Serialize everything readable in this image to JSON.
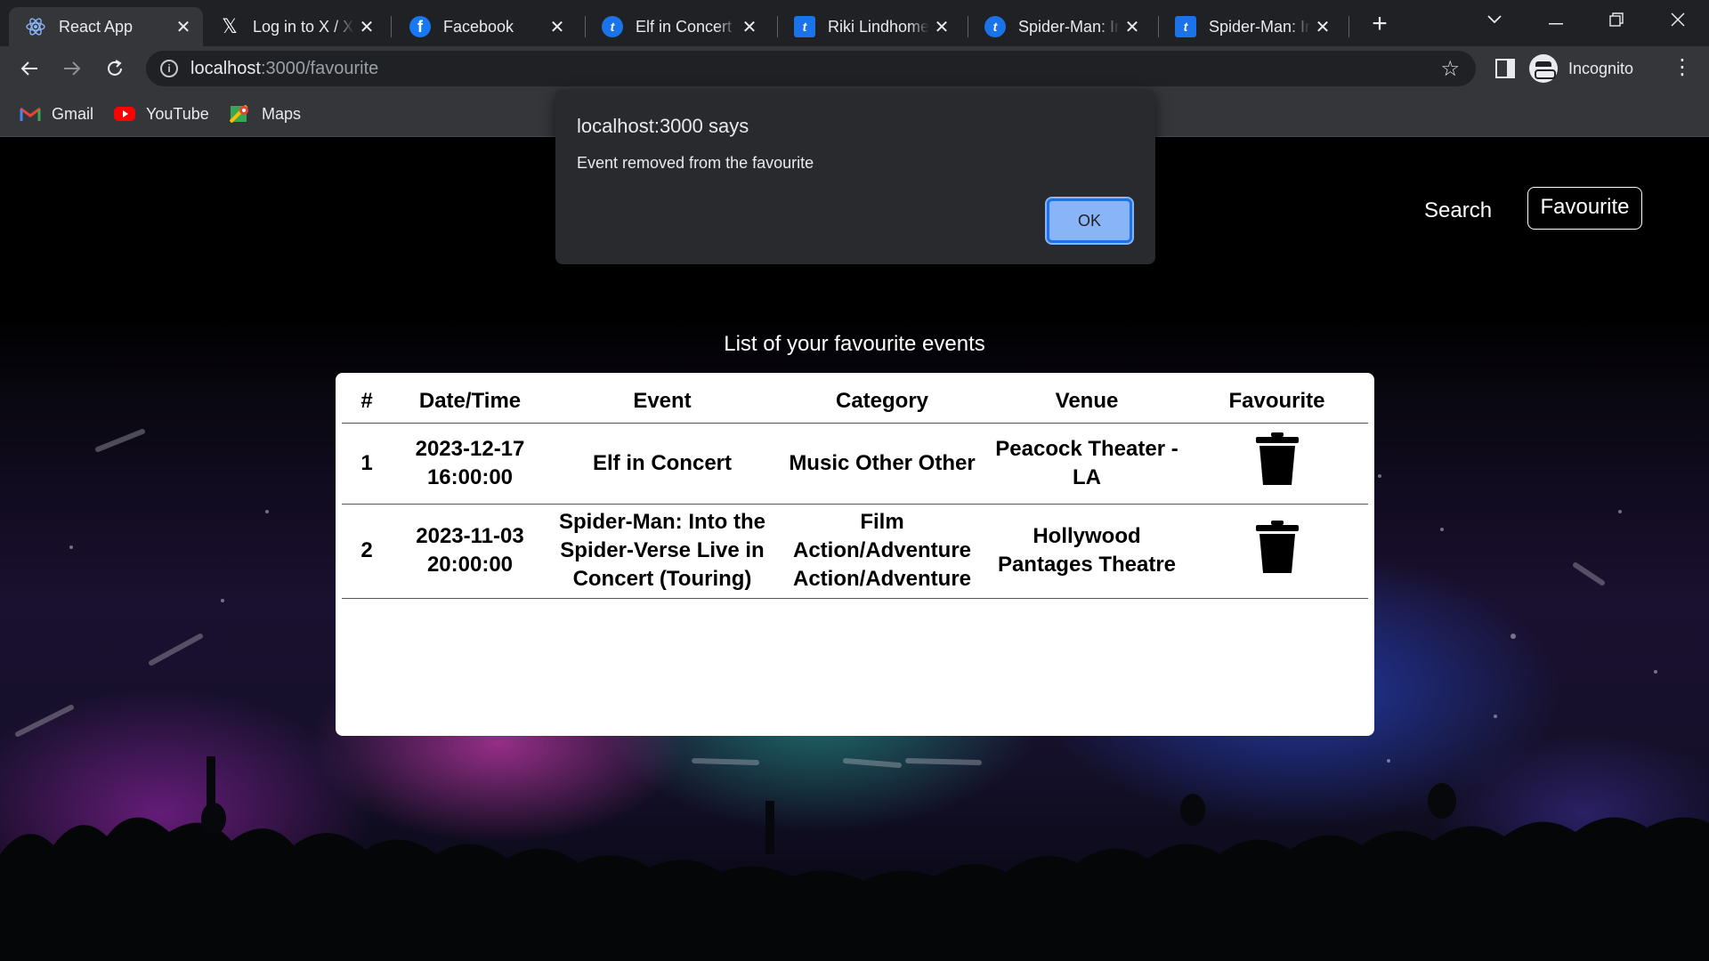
{
  "browser": {
    "tabs": [
      {
        "title": "React App",
        "icon": "react-icon",
        "active": true
      },
      {
        "title": "Log in to X / X",
        "icon": "x-logo-icon"
      },
      {
        "title": "Facebook",
        "icon": "facebook-icon"
      },
      {
        "title": "Elf in Concert",
        "icon": "ticketmaster-icon"
      },
      {
        "title": "Riki Lindhome",
        "icon": "ticketmaster-icon"
      },
      {
        "title": "Spider-Man: In",
        "icon": "ticketmaster-icon"
      },
      {
        "title": "Spider-Man: In",
        "icon": "ticketmaster-icon"
      }
    ],
    "address": {
      "host": "localhost",
      "path": ":3000/favourite"
    },
    "profile_label": "Incognito",
    "bookmarks": [
      {
        "label": "Gmail",
        "icon": "gmail-icon"
      },
      {
        "label": "YouTube",
        "icon": "youtube-icon"
      },
      {
        "label": "Maps",
        "icon": "maps-icon"
      }
    ]
  },
  "app": {
    "nav": {
      "search": "Search",
      "favourite": "Favourite"
    },
    "list_heading": "List of your favourite events",
    "table": {
      "headers": [
        "#",
        "Date/Time",
        "Event",
        "Category",
        "Venue",
        "Favourite"
      ],
      "rows": [
        {
          "num": "1",
          "date": "2023-12-17",
          "time": "16:00:00",
          "event": [
            "Elf in Concert"
          ],
          "category": [
            "Music Other Other"
          ],
          "venue": [
            "Peacock Theater -",
            "LA"
          ]
        },
        {
          "num": "2",
          "date": "2023-11-03",
          "time": "20:00:00",
          "event": [
            "Spider-Man: Into the",
            "Spider-Verse Live in",
            "Concert (Touring)"
          ],
          "category": [
            "Film",
            "Action/Adventure",
            "Action/Adventure"
          ],
          "venue": [
            "Hollywood",
            "Pantages Theatre"
          ]
        }
      ]
    }
  },
  "dialog": {
    "title": "localhost:3000 says",
    "message": "Event removed from the favourite",
    "ok_label": "OK"
  },
  "colors": {
    "tabstrip": "#202124",
    "toolbar": "#35363a",
    "dialog_bg": "#292a2d",
    "ok_button": "#8ab4f8",
    "ok_border": "#1a73e8"
  }
}
